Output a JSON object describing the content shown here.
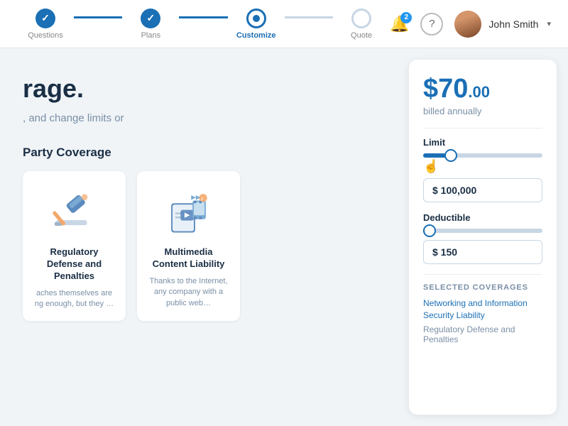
{
  "header": {
    "steps": [
      {
        "id": "questions",
        "label": "Questions",
        "state": "done"
      },
      {
        "id": "plans",
        "label": "Plans",
        "state": "done"
      },
      {
        "id": "customize",
        "label": "Customize",
        "state": "active"
      },
      {
        "id": "quote",
        "label": "Quote",
        "state": "inactive"
      }
    ],
    "notifications": {
      "badge": "2",
      "icon": "🔔"
    },
    "help_icon": "?",
    "user": {
      "name": "John Smith",
      "avatar_initials": "JS"
    }
  },
  "main": {
    "left": {
      "title": "rage.",
      "subtitle": ", and change limits or",
      "section_heading": "Party Coverage",
      "cards": [
        {
          "id": "regulatory-defense",
          "title": "Regulatory Defense and Penalties",
          "description": "aches themselves are ng enough, but they …",
          "icon_type": "gavel"
        },
        {
          "id": "multimedia-content",
          "title": "Multimedia Content Liability",
          "description": "Thanks to the Internet, any company with a public web…",
          "icon_type": "media"
        }
      ]
    },
    "right": {
      "pricing_card": {
        "price_main": "$70",
        "price_cents": ".00",
        "billed_label": "billed annually",
        "limit": {
          "label": "Limit",
          "value": "$ 100,000"
        },
        "deductible": {
          "label": "Deductible",
          "value": "$ 150"
        },
        "selected_coverages": {
          "label": "SELECTED COVERAGES",
          "items": [
            "Networking and Information Security Liability",
            "Regulatory Defense and Penalties"
          ]
        }
      }
    }
  }
}
